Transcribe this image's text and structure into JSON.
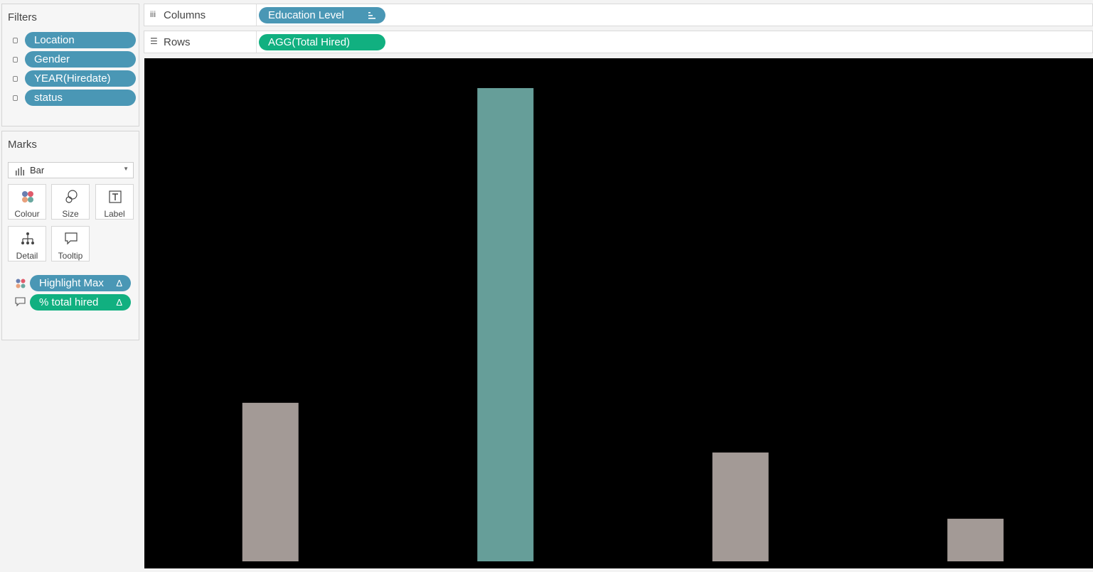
{
  "filters": {
    "title": "Filters",
    "items": [
      "Location",
      "Gender",
      "YEAR(Hiredate)",
      "status"
    ]
  },
  "marks": {
    "title": "Marks",
    "type_selected": "Bar",
    "cards": {
      "colour": "Colour",
      "size": "Size",
      "label": "Label",
      "detail": "Detail",
      "tooltip": "Tooltip"
    },
    "fields": [
      {
        "label": "Highlight Max",
        "delta": "Δ",
        "encoding": "colour",
        "color": "#4a97b5"
      },
      {
        "label": "% total hired",
        "delta": "Δ",
        "encoding": "tooltip",
        "color": "#11b080"
      }
    ]
  },
  "shelves": {
    "columns": {
      "label": "Columns",
      "pill": "Education Level"
    },
    "rows": {
      "label": "Rows",
      "pill": "AGG(Total Hired)"
    }
  },
  "colors": {
    "dimension_pill": "#4a97b5",
    "measure_pill": "#11b080",
    "chart_background": "#000000",
    "bar_max": "#669e99",
    "bar_other": "#a39a96"
  },
  "chart_data": {
    "type": "bar",
    "categories": [
      "",
      "",
      "",
      ""
    ],
    "values": [
      33.5,
      100,
      23,
      9
    ],
    "highlight": [
      false,
      true,
      false,
      false
    ],
    "ylim": [
      0,
      106
    ],
    "grid": false,
    "title": "",
    "xlabel": "",
    "ylabel": ""
  }
}
